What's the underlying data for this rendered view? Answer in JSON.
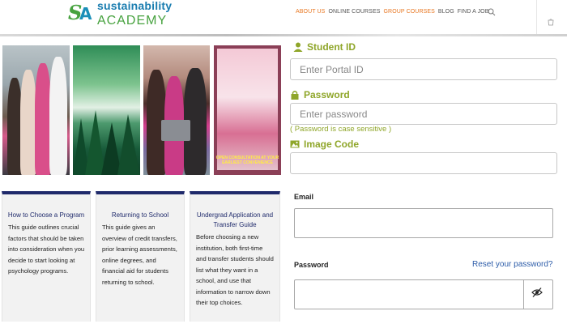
{
  "logo": {
    "mark": "S",
    "mark_accent": "A",
    "line1": "sustainability",
    "line2": "ACADEMY"
  },
  "nav": {
    "items": [
      {
        "label": "ABOUT US",
        "highlight": true
      },
      {
        "label": "ONLINE COURSES",
        "highlight": false
      },
      {
        "label": "GROUP COURSES",
        "highlight": true
      },
      {
        "label": "BLOG",
        "highlight": false
      },
      {
        "label": "FIND A JOB",
        "highlight": false
      }
    ]
  },
  "photo_caption": "OPEN CONSULTATION AT YOUR EARLIEST CONVENIENCE",
  "cards": [
    {
      "title": "How to Choose a Program",
      "body": "This guide outlines crucial factors that should be taken into consideration when you decide to start looking at psychology programs."
    },
    {
      "title": "Returning to School",
      "body": "This guide gives an overview of credit transfers, prior learning assessments, online degrees, and financial aid for students returning to school."
    },
    {
      "title": "Undergrad Application and Transfer Guide",
      "body": "Before choosing a new institution, both first-time and transfer students should list what they want in a school, and use that information to narrow down their top choices."
    }
  ],
  "portal_form": {
    "student_id_label": "Student ID",
    "student_id_placeholder": "Enter Portal ID",
    "password_label": "Password",
    "password_placeholder": "Enter password",
    "password_hint": "( Password is case sensitive )",
    "image_code_label": "Image Code",
    "image_code_value": ""
  },
  "login_form": {
    "email_label": "Email",
    "email_value": "",
    "password_label": "Password",
    "reset_link": "Reset your password?",
    "password_value": ""
  },
  "colors": {
    "accent_orange": "#e87722",
    "label_green": "#8fa62a",
    "brand_blue": "#1a7db0",
    "card_border_navy": "#1f2a6b",
    "link_blue": "#2b5ba8"
  },
  "icons": [
    "person-icon",
    "lock-icon",
    "image-icon",
    "search-icon",
    "cart-icon",
    "eye-slash-icon"
  ]
}
